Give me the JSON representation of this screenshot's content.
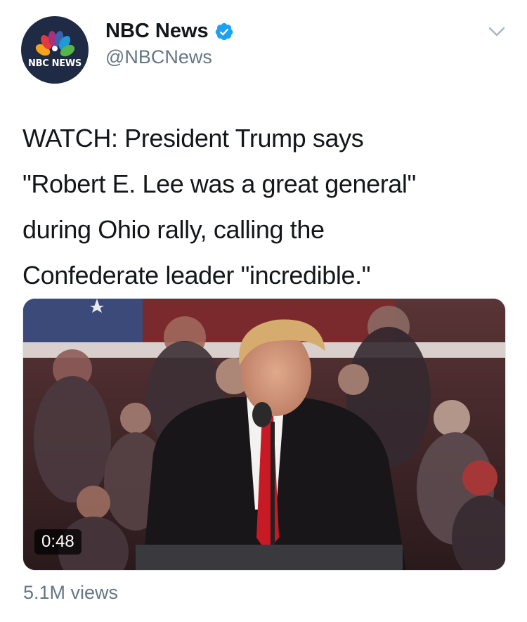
{
  "account": {
    "display_name": "NBC News",
    "handle": "@NBCNews",
    "avatar_text": "NBC NEWS",
    "verified": true
  },
  "tweet": {
    "text_lines": [
      "WATCH: President Trump says",
      "\"Robert E. Lee was a great general\"",
      "during Ohio rally, calling the",
      "Confederate leader \"incredible.\""
    ]
  },
  "video": {
    "duration": "0:48"
  },
  "stats": {
    "views": "5.1M views"
  },
  "colors": {
    "text": "#14171a",
    "secondary": "#657786",
    "verified_blue": "#1da1f2",
    "avatar_bg": "#1f2a44"
  },
  "icons": [
    "nbc-peacock-icon",
    "verified-badge-icon",
    "chevron-down-icon"
  ]
}
